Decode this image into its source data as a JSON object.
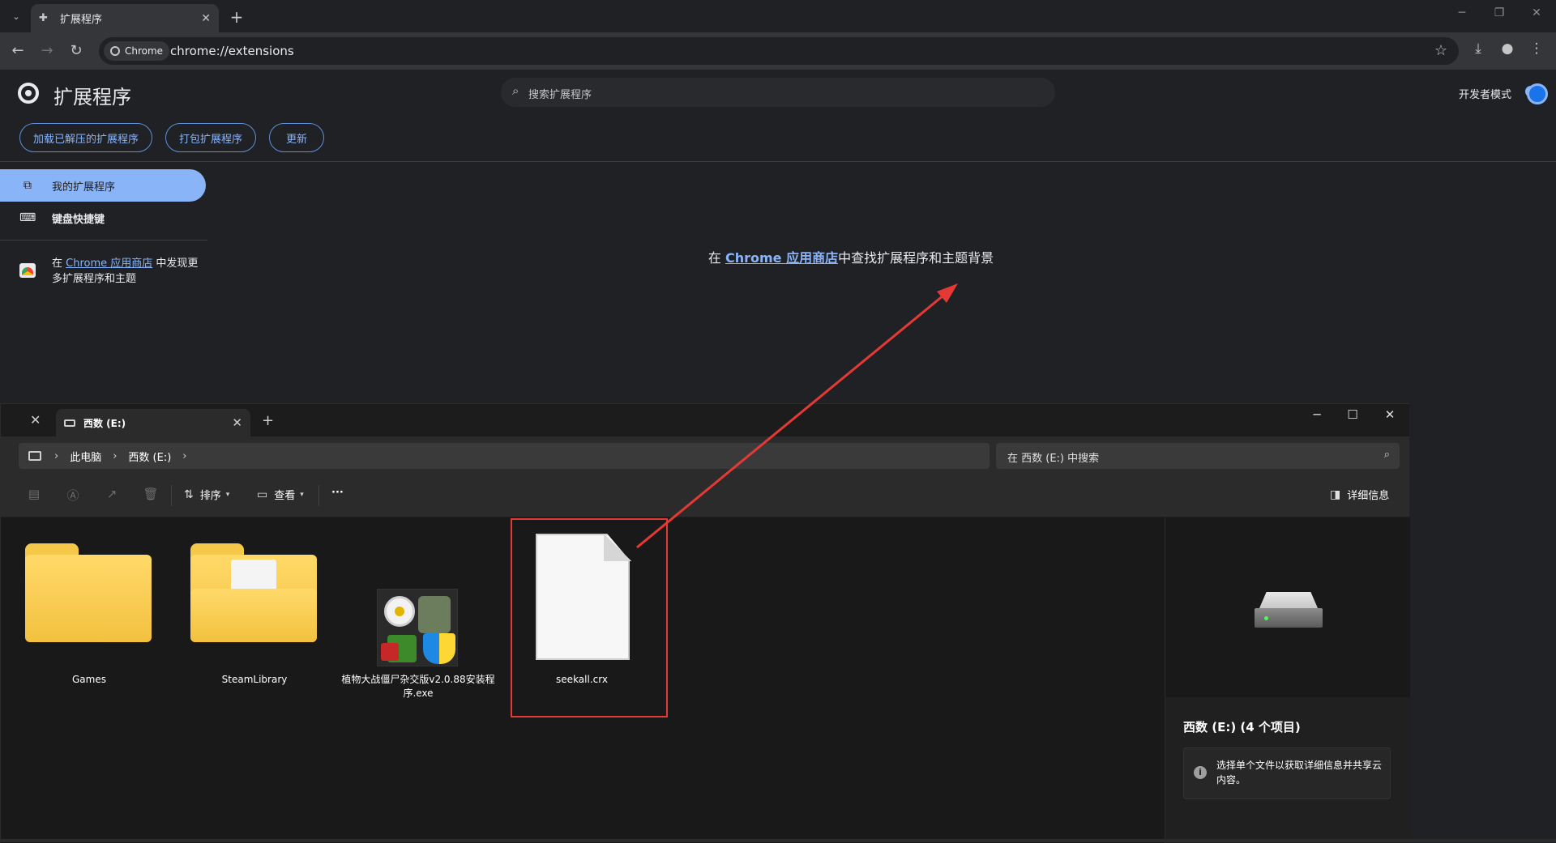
{
  "browser": {
    "tab_title": "扩展程序",
    "chip_label": "Chrome",
    "url": "chrome://extensions"
  },
  "extensions_page": {
    "title": "扩展程序",
    "search_placeholder": "搜索扩展程序",
    "developer_mode_label": "开发者模式",
    "developer_mode_on": true,
    "buttons": {
      "load_unpacked": "加载已解压的扩展程序",
      "pack": "打包扩展程序",
      "update": "更新"
    },
    "sidebar": {
      "my_extensions": "我的扩展程序",
      "shortcuts": "键盘快捷键",
      "store_prefix": "在 ",
      "store_link": "Chrome 应用商店",
      "store_suffix": " 中发现更多扩展程序和主题"
    },
    "center": {
      "prefix": "在 ",
      "link": "Chrome 应用商店",
      "suffix": "中查找扩展程序和主题背景"
    }
  },
  "explorer": {
    "tab_title": "西数 (E:)",
    "breadcrumb": [
      "此电脑",
      "西数 (E:)"
    ],
    "search_placeholder": "在 西数 (E:) 中搜索",
    "commands": {
      "sort": "排序",
      "view": "查看",
      "more": "···",
      "details": "详细信息"
    },
    "items": [
      {
        "name": "Games",
        "type": "folder"
      },
      {
        "name": "SteamLibrary",
        "type": "folder"
      },
      {
        "name": "植物大战僵尸杂交版v2.0.88安装程序.exe",
        "type": "exe"
      },
      {
        "name": "seekall.crx",
        "type": "file"
      }
    ],
    "details_pane": {
      "title": "西数 (E:) (4 个项目)",
      "info": "选择单个文件以获取详细信息并共享云内容。"
    }
  },
  "annotation": {
    "color": "#e53935"
  }
}
